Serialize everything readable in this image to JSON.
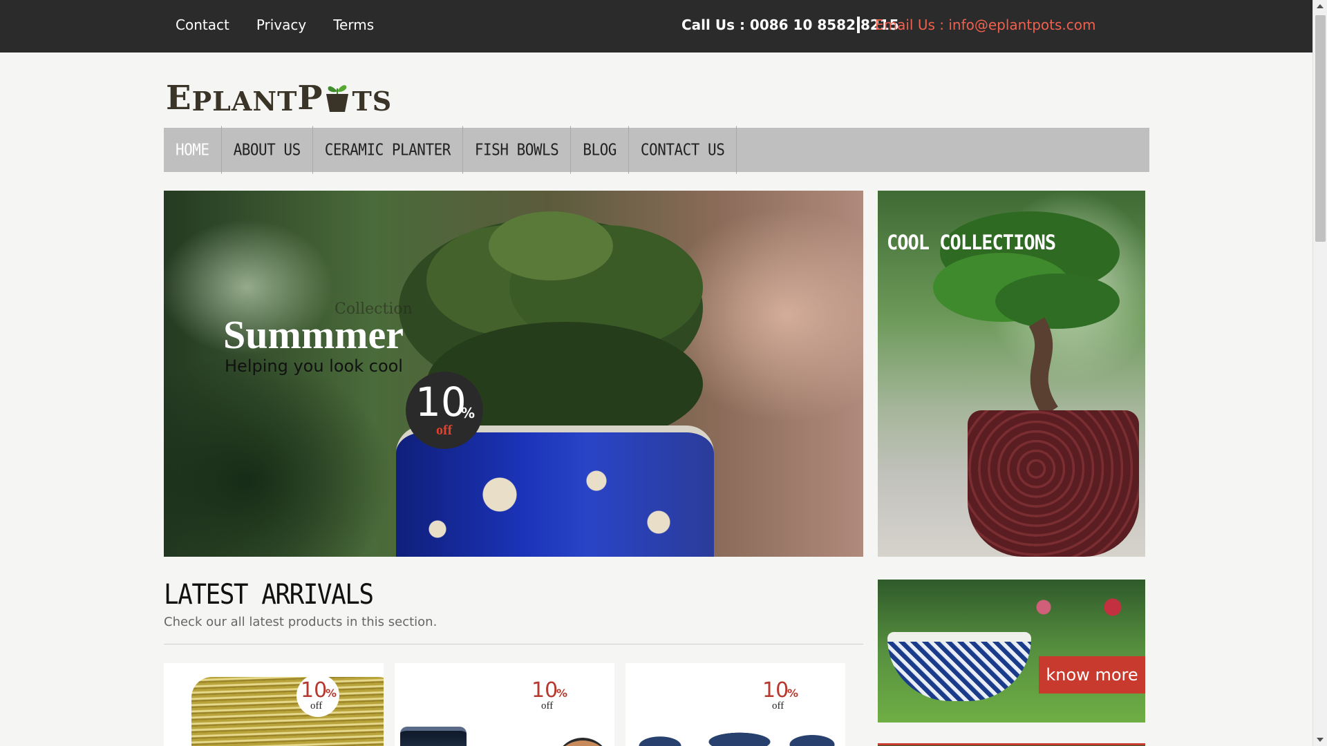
{
  "topbar": {
    "links": [
      "Contact",
      "Privacy",
      "Terms"
    ],
    "call": "Call Us : 0086 10 8582 8215",
    "email": "Email Us : info@eplantpots.com"
  },
  "logo": {
    "text_e": "E",
    "text_plant": "PLANT",
    "text_p": "P",
    "text_ts": "TS"
  },
  "nav": {
    "items": [
      "HOME",
      "ABOUT US",
      "CERAMIC PLANTER",
      "FISH BOWLS",
      "BLOG",
      "CONTACT US"
    ],
    "active": "HOME"
  },
  "hero": {
    "collection": "Collection",
    "title": "Summmer",
    "subtitle": "Helping you look cool",
    "badge_num": "10",
    "badge_pct": "%",
    "badge_off": "off"
  },
  "side": {
    "cool_title": "COOL COLLECTIONS",
    "know_more": "know more"
  },
  "latest": {
    "title": "LATEST ARRIVALS",
    "subtitle": "Check our all latest products in this section.",
    "cards": [
      {
        "num": "10",
        "pct": "%",
        "off": "off"
      },
      {
        "num": "10",
        "pct": "%",
        "off": "off"
      },
      {
        "num": "10",
        "pct": "%",
        "off": "off"
      }
    ]
  },
  "colors": {
    "topbar": "#2b2b2b",
    "accent": "#f0604e",
    "nav_bg": "#bfbfbf",
    "button_red": "#c83a2e"
  }
}
